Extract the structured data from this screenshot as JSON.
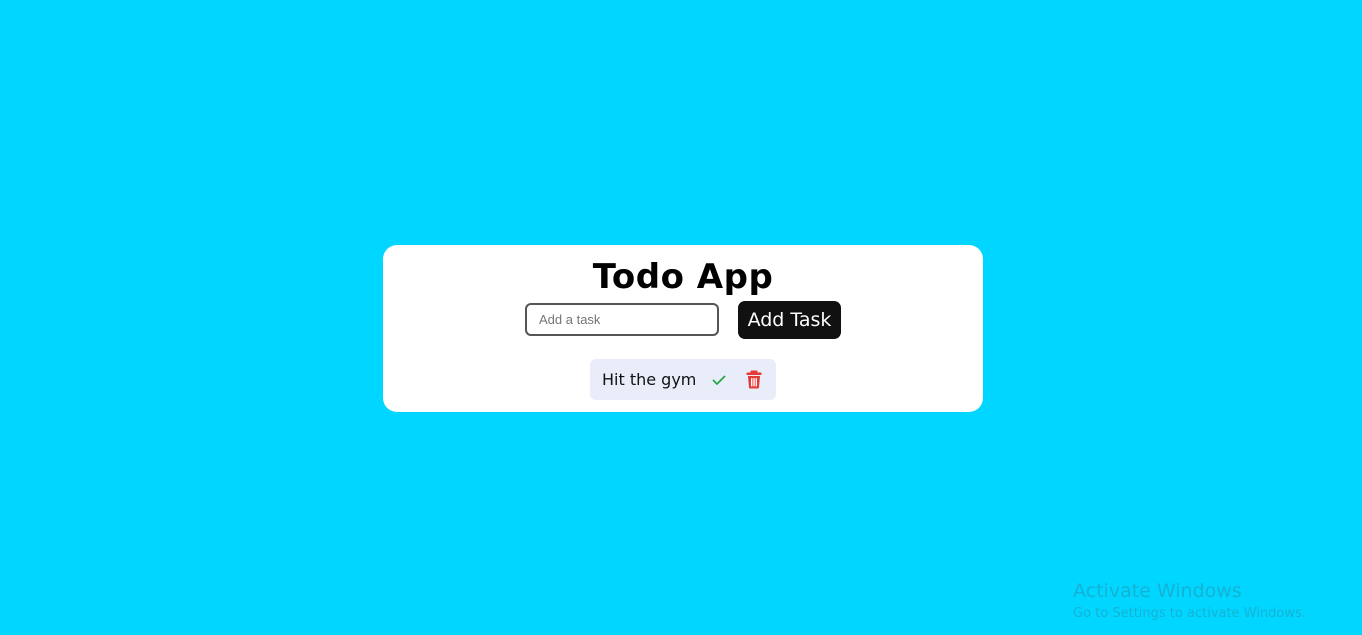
{
  "app": {
    "title": "Todo App"
  },
  "form": {
    "input_placeholder": "Add a task",
    "input_value": "",
    "add_button_label": "Add Task"
  },
  "tasks": [
    {
      "text": "Hit the gym",
      "complete_icon": "check-icon",
      "delete_icon": "trash-icon"
    }
  ],
  "watermark": {
    "title": "Activate Windows",
    "subtitle": "Go to Settings to activate Windows."
  },
  "colors": {
    "background": "#00d6ff",
    "card": "#ffffff",
    "button": "#111111",
    "task_bg": "#e8edf9",
    "check": "#28a745",
    "delete": "#e53935"
  }
}
